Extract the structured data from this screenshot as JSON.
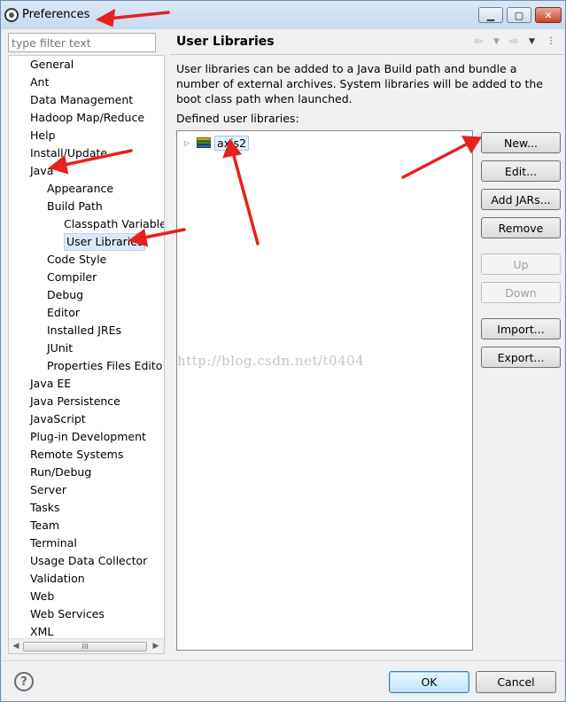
{
  "window": {
    "title": "Preferences",
    "controls": [
      "minimize",
      "maximize",
      "close"
    ]
  },
  "sidebar": {
    "filter_placeholder": "type filter text",
    "items": [
      {
        "label": "General",
        "level": 0
      },
      {
        "label": "Ant",
        "level": 0
      },
      {
        "label": "Data Management",
        "level": 0
      },
      {
        "label": "Hadoop Map/Reduce",
        "level": 0
      },
      {
        "label": "Help",
        "level": 0
      },
      {
        "label": "Install/Update",
        "level": 0
      },
      {
        "label": "Java",
        "level": 0
      },
      {
        "label": "Appearance",
        "level": 1
      },
      {
        "label": "Build Path",
        "level": 1
      },
      {
        "label": "Classpath Variable",
        "level": 2
      },
      {
        "label": "User Libraries",
        "level": 2,
        "selected": true
      },
      {
        "label": "Code Style",
        "level": 1
      },
      {
        "label": "Compiler",
        "level": 1
      },
      {
        "label": "Debug",
        "level": 1
      },
      {
        "label": "Editor",
        "level": 1
      },
      {
        "label": "Installed JREs",
        "level": 1
      },
      {
        "label": "JUnit",
        "level": 1
      },
      {
        "label": "Properties Files Edito",
        "level": 1
      },
      {
        "label": "Java EE",
        "level": 0
      },
      {
        "label": "Java Persistence",
        "level": 0
      },
      {
        "label": "JavaScript",
        "level": 0
      },
      {
        "label": "Plug-in Development",
        "level": 0
      },
      {
        "label": "Remote Systems",
        "level": 0
      },
      {
        "label": "Run/Debug",
        "level": 0
      },
      {
        "label": "Server",
        "level": 0
      },
      {
        "label": "Tasks",
        "level": 0
      },
      {
        "label": "Team",
        "level": 0
      },
      {
        "label": "Terminal",
        "level": 0
      },
      {
        "label": "Usage Data Collector",
        "level": 0
      },
      {
        "label": "Validation",
        "level": 0
      },
      {
        "label": "Web",
        "level": 0
      },
      {
        "label": "Web Services",
        "level": 0
      },
      {
        "label": "XML",
        "level": 0
      }
    ],
    "scroll_thumb_glyph": "III"
  },
  "main": {
    "title": "User Libraries",
    "nav_icons": [
      "back-arrow-icon",
      "dropdown-icon",
      "forward-arrow-icon",
      "dropdown-icon",
      "view-menu-icon"
    ],
    "description": "User libraries can be added to a Java Build path and bundle a number of external archives. System libraries will be added to the boot class path when launched.",
    "defined_label": "Defined user libraries:",
    "libraries": [
      {
        "name": "axis2",
        "expanded": false
      }
    ],
    "buttons": {
      "new": "New...",
      "edit": "Edit...",
      "add_jars": "Add JARs...",
      "remove": "Remove",
      "up": "Up",
      "down": "Down",
      "import": "Import...",
      "export": "Export..."
    },
    "watermark": "http://blog.csdn.net/t0404"
  },
  "footer": {
    "help_glyph": "?",
    "ok": "OK",
    "cancel": "Cancel"
  },
  "colors": {
    "annotation_arrows": "#e8201a",
    "selection": "#dbe8f7"
  }
}
